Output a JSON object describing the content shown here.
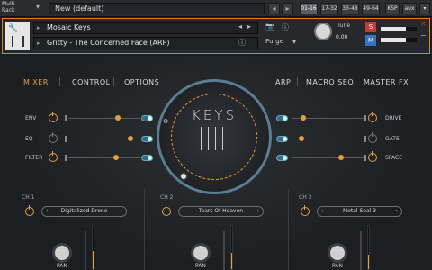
{
  "topbar": {
    "label": "Multi Rack",
    "rack_name": "New (default)",
    "ranges": [
      "01-16",
      "17-32",
      "33-48",
      "49-64"
    ],
    "ksp": "KSP",
    "aux": "aux"
  },
  "instrument": {
    "name": "Mosaic Keys",
    "preset": "Gritty - The Concerned Face (ARP)",
    "purge_label": "Purge",
    "tune_label": "Tune",
    "tune_value": "0.00",
    "solo": "S",
    "mute": "M",
    "output_meter_levels": [
      0.7,
      0.7
    ]
  },
  "nav": {
    "mixer": "MIXER",
    "control": "CONTROL",
    "options": "OPTIONS",
    "arp": "ARP",
    "macro_seq": "MACRO SEQ",
    "master_fx": "MASTER FX"
  },
  "left_rows": [
    {
      "label": "ENV"
    },
    {
      "label": "EQ"
    },
    {
      "label": "FILTER"
    }
  ],
  "right_rows": [
    {
      "label": "DRIVE"
    },
    {
      "label": "GATE"
    },
    {
      "label": "SPACE"
    }
  ],
  "dial": {
    "title": "KEYS"
  },
  "channels": [
    {
      "label": "CH 1",
      "sound": "Digitalized Drone",
      "pan_label": "PAN"
    },
    {
      "label": "CH 2",
      "sound": "Tears Of Heaven",
      "pan_label": "PAN"
    },
    {
      "label": "CH 3",
      "sound": "Metal Seal 3",
      "pan_label": "PAN"
    }
  ],
  "colors": {
    "accent": "#e0a040",
    "header_border": "#e0801a",
    "dial_ring": "#5a7d92"
  }
}
